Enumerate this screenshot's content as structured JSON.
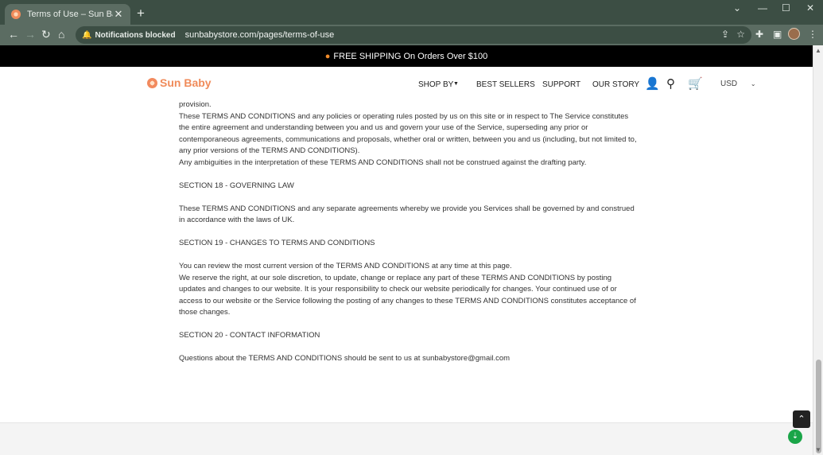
{
  "browser": {
    "tab_title": "Terms of Use – Sun Baby",
    "new_tab": "+",
    "notifications": "Notifications blocked",
    "url": "sunbabystore.com/pages/terms-of-use"
  },
  "announcement": "FREE SHIPPING On Orders Over $100",
  "header": {
    "logo": "Sun Baby",
    "nav": [
      "SHOP BY",
      "BEST SELLERS",
      "SUPPORT",
      "OUR STORY"
    ],
    "currency": "USD"
  },
  "content": {
    "p1_partial": "provision.",
    "p2": "These TERMS AND CONDITIONS and any policies or operating rules posted by us on this site or in respect to The Service constitutes the entire agreement and understanding between you and us and govern your use of the Service, superseding any prior or contemporaneous agreements, communications and proposals, whether oral or written, between you and us (including, but not limited to, any prior versions of the TERMS AND CONDITIONS).",
    "p3": "Any ambiguities in the interpretation of these TERMS AND CONDITIONS shall not be construed against the drafting party.",
    "s18": "SECTION 18 - GOVERNING LAW",
    "p18": "These TERMS AND CONDITIONS and any separate agreements whereby we provide you Services shall be governed by and construed in accordance with the laws of UK.",
    "s19": "SECTION 19 - CHANGES TO TERMS AND CONDITIONS",
    "p19a": "You can review the most current version of the TERMS AND CONDITIONS at any time at this page.",
    "p19b": "We reserve the right, at our sole discretion, to update, change or replace any part of these TERMS AND CONDITIONS by posting updates and changes to our website. It is your responsibility to check our website periodically for changes. Your continued use of or access to our website or the Service following the posting of any changes to these TERMS AND CONDITIONS constitutes acceptance of those changes.",
    "s20": "SECTION 20 - CONTACT INFORMATION",
    "p20": "Questions about the TERMS AND CONDITIONS should be sent to us at sunbabystore@gmail.com"
  }
}
